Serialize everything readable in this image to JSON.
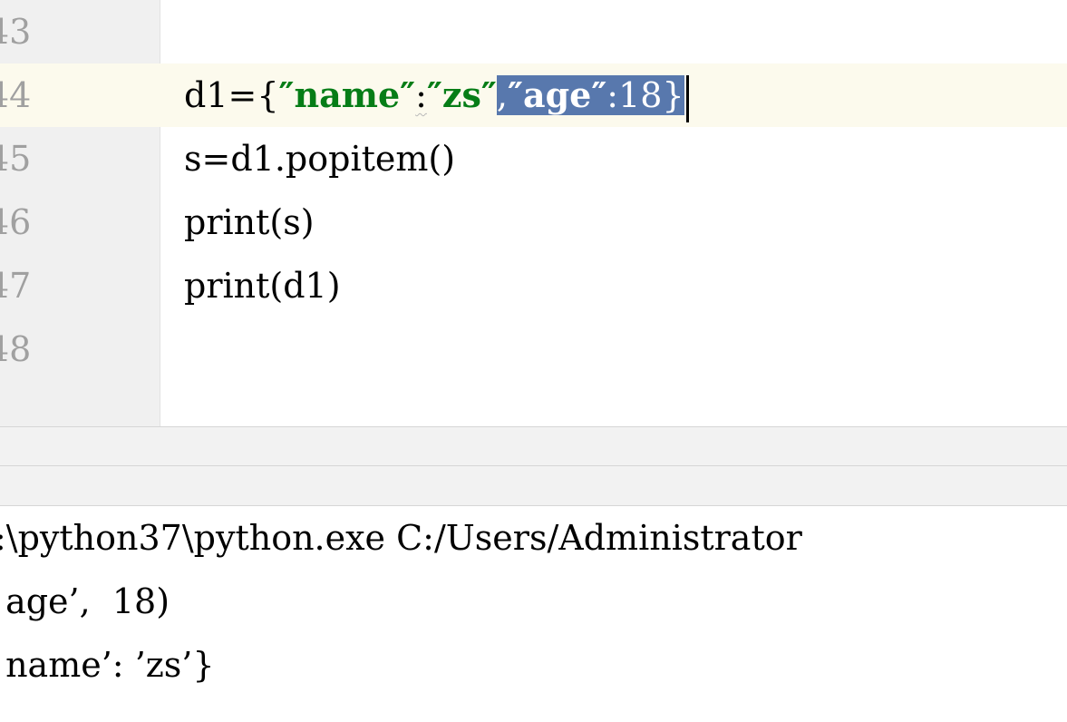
{
  "editor": {
    "lines": [
      {
        "num": "43",
        "text": ""
      },
      {
        "num": "44",
        "prefix": "d1={",
        "str_name": "″name″",
        "colon": ":",
        "str_zs": "″zs″",
        "selected_comma": ",",
        "selected_age": "″age″",
        "selected_rest": ":18}"
      },
      {
        "num": "45",
        "text": "s=d1.popitem()"
      },
      {
        "num": "46",
        "text": "print(s)"
      },
      {
        "num": "47",
        "text": "print(d1)"
      },
      {
        "num": "48",
        "text": ""
      }
    ]
  },
  "console": {
    "lines": [
      ":\\python37\\python.exe C:/Users/Administrator",
      " age’,  18)",
      " name’: ’zs’}"
    ]
  },
  "colors": {
    "current_line": "#fcfaed",
    "selection": "#5878ad",
    "string": "#067d17",
    "gutter": "#f0f0f0"
  }
}
